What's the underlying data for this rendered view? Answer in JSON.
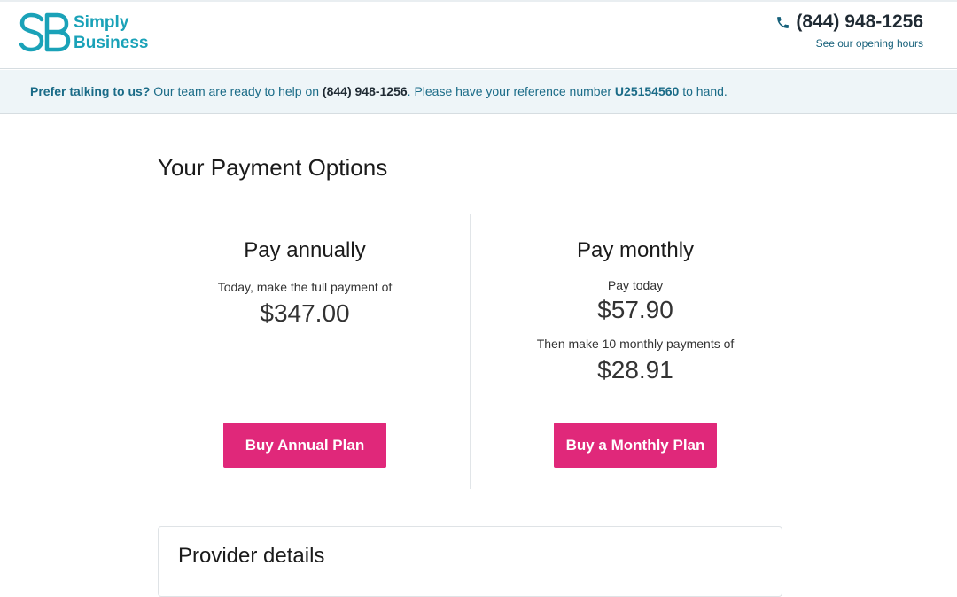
{
  "header": {
    "logo_line1": "Simply",
    "logo_line2": "Business",
    "phone": "(844) 948-1256",
    "hours_link": "See our opening hours"
  },
  "banner": {
    "lead": "Prefer talking to us?",
    "text1": " Our team are ready to help on ",
    "phone": "(844) 948-1256",
    "text2": ". Please have your reference number ",
    "reference": "U25154560",
    "text3": " to hand."
  },
  "main": {
    "title": "Your Payment Options",
    "annual": {
      "heading": "Pay annually",
      "subtext": "Today, make the full payment of",
      "price": "$347.00",
      "button": "Buy Annual Plan"
    },
    "monthly": {
      "heading": "Pay monthly",
      "today_label": "Pay today",
      "today_price": "$57.90",
      "then_label": "Then make 10 monthly payments of",
      "monthly_price": "$28.91",
      "button": "Buy a Monthly Plan"
    }
  },
  "provider": {
    "heading": "Provider details"
  },
  "colors": {
    "brand_teal": "#1aa2b8",
    "button_pink": "#e0287a",
    "banner_bg": "#eef5f8"
  }
}
